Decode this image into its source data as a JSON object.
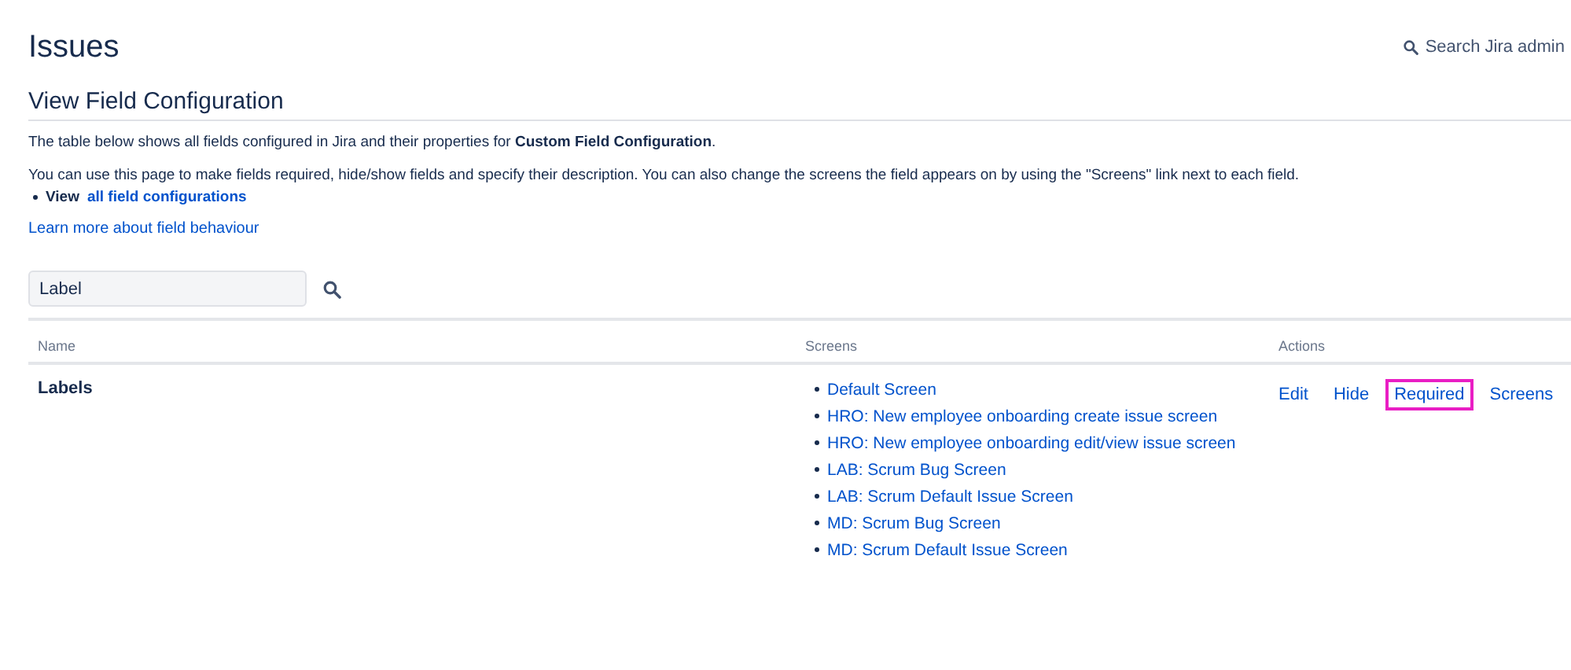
{
  "header": {
    "title": "Issues",
    "search_link": "Search Jira admin"
  },
  "section": {
    "title": "View Field Configuration",
    "intro": "The table below shows all fields configured in Jira and their properties for **Custom Field Configuration**.",
    "description": "You can use this page to make fields required, hide/show fields and specify their description. You can also change the screens the field appears on by using the \"Screens\" link next to each field.",
    "view_label": "View",
    "view_link": "all field configurations",
    "learn_more": "Learn more about field behaviour"
  },
  "filter": {
    "value": "Label"
  },
  "table": {
    "columns": [
      "Name",
      "Screens",
      "Actions"
    ],
    "rows": [
      {
        "name": "Labels",
        "screens": [
          "Default Screen",
          "HRO: New employee onboarding create issue screen",
          "HRO: New employee onboarding edit/view issue screen",
          "LAB: Scrum Bug Screen",
          "LAB: Scrum Default Issue Screen",
          "MD: Scrum Bug Screen",
          "MD: Scrum Default Issue Screen"
        ],
        "actions": [
          {
            "label": "Edit",
            "highlighted": false
          },
          {
            "label": "Hide",
            "highlighted": false
          },
          {
            "label": "Required",
            "highlighted": true
          },
          {
            "label": "Screens",
            "highlighted": false
          }
        ]
      }
    ]
  }
}
